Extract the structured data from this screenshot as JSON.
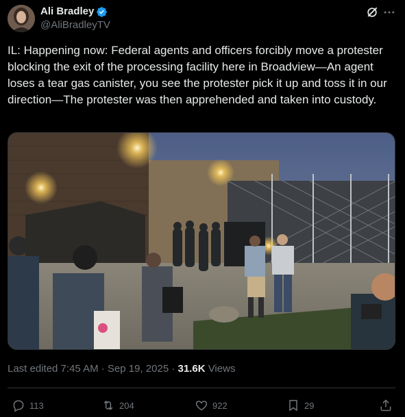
{
  "author": {
    "name": "Ali Bradley",
    "handle": "@AliBradleyTV"
  },
  "post": {
    "text": "IL: Happening now: Federal agents and officers forcibly move a protester blocking the exit of the processing facility here in Broadview—An agent loses a tear gas canister, you see the protester pick it up and toss it in our direction—The protester was then apprehended and taken into custody."
  },
  "meta": {
    "edited": "Last edited 7:45 AM · Sep 19, 2025 · ",
    "views_count": "31.6K",
    "views_label": " Views"
  },
  "actions": {
    "replies": "113",
    "reposts": "204",
    "likes": "922",
    "bookmarks": "29"
  },
  "colors": {
    "background": "#000000",
    "text": "#e7e9ea",
    "secondary": "#71767b",
    "verified": "#1d9bf0"
  },
  "icons": {
    "verified": "verified-badge-icon",
    "grok": "grok-icon",
    "more": "more-icon",
    "reply": "reply-icon",
    "repost": "repost-icon",
    "like": "heart-icon",
    "bookmark": "bookmark-icon",
    "share": "share-icon"
  }
}
